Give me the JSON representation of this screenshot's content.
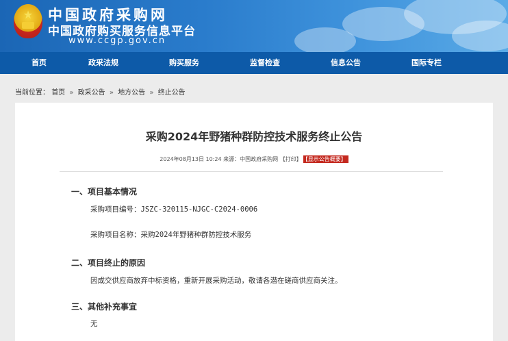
{
  "header": {
    "site_name": "中国政府采购网",
    "platform_name": "中国政府购买服务信息平台",
    "url": "www.ccgp.gov.cn"
  },
  "nav": {
    "items": [
      "首页",
      "政采法规",
      "购买服务",
      "监督检查",
      "信息公告",
      "国际专栏"
    ]
  },
  "breadcrumb": {
    "prefix": "当前位置：",
    "items": [
      "首页",
      "政采公告",
      "地方公告",
      "终止公告"
    ],
    "separator": "»"
  },
  "notice": {
    "title": "采购2024年野猪种群防控技术服务终止公告",
    "meta": "2024年08月13日 10:24 来源：中国政府采购网 【打印】",
    "summary_badge": "【显示公告概要】",
    "sections": [
      {
        "heading": "一、项目基本情况",
        "lines": [
          "采购项目编号：JSZC-320115-NJGC-C2024-0006",
          "采购项目名称：采购2024年野猪种群防控技术服务"
        ]
      },
      {
        "heading": "二、项目终止的原因",
        "lines": [
          "因成交供应商放弃中标资格，重新开展采购活动，敬请各潜在磋商供应商关注。"
        ]
      },
      {
        "heading": "三、其他补充事宜",
        "lines": [
          "无"
        ]
      }
    ]
  },
  "colors": {
    "header_blue": "#1b66b5",
    "nav_blue": "#0d5aa8",
    "badge_red": "#c4291f"
  }
}
